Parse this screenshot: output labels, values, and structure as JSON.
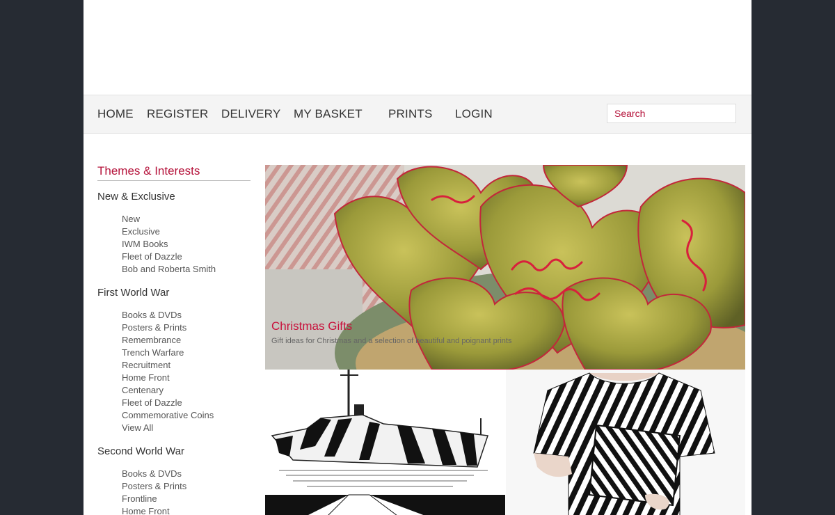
{
  "nav": {
    "home": "HOME",
    "register": "REGISTER",
    "delivery": "DELIVERY",
    "basket": "MY BASKET",
    "prints": "PRINTS",
    "login": "LOGIN"
  },
  "search": {
    "placeholder": "Search"
  },
  "sidebar": {
    "title": "Themes & Interests",
    "sections": [
      {
        "title": "New & Exclusive",
        "items": [
          "New",
          "Exclusive",
          "IWM Books",
          "Fleet of Dazzle",
          "Bob and Roberta Smith"
        ]
      },
      {
        "title": "First World War",
        "items": [
          "Books & DVDs",
          "Posters & Prints",
          "Remembrance",
          "Trench Warfare",
          "Recruitment",
          "Home Front",
          "Centenary",
          "Fleet of Dazzle",
          "Commemorative Coins",
          "View All"
        ]
      },
      {
        "title": "Second World War",
        "items": [
          "Books & DVDs",
          "Posters & Prints",
          "Frontline",
          "Home Front"
        ]
      }
    ]
  },
  "hero": {
    "title": "Christmas Gifts",
    "text": "Gift ideas for Christmas and a selection of beautiful and poignant prints"
  },
  "colors": {
    "accent": "#b5123a",
    "background": "#262b33",
    "navbar": "#f4f4f4"
  }
}
